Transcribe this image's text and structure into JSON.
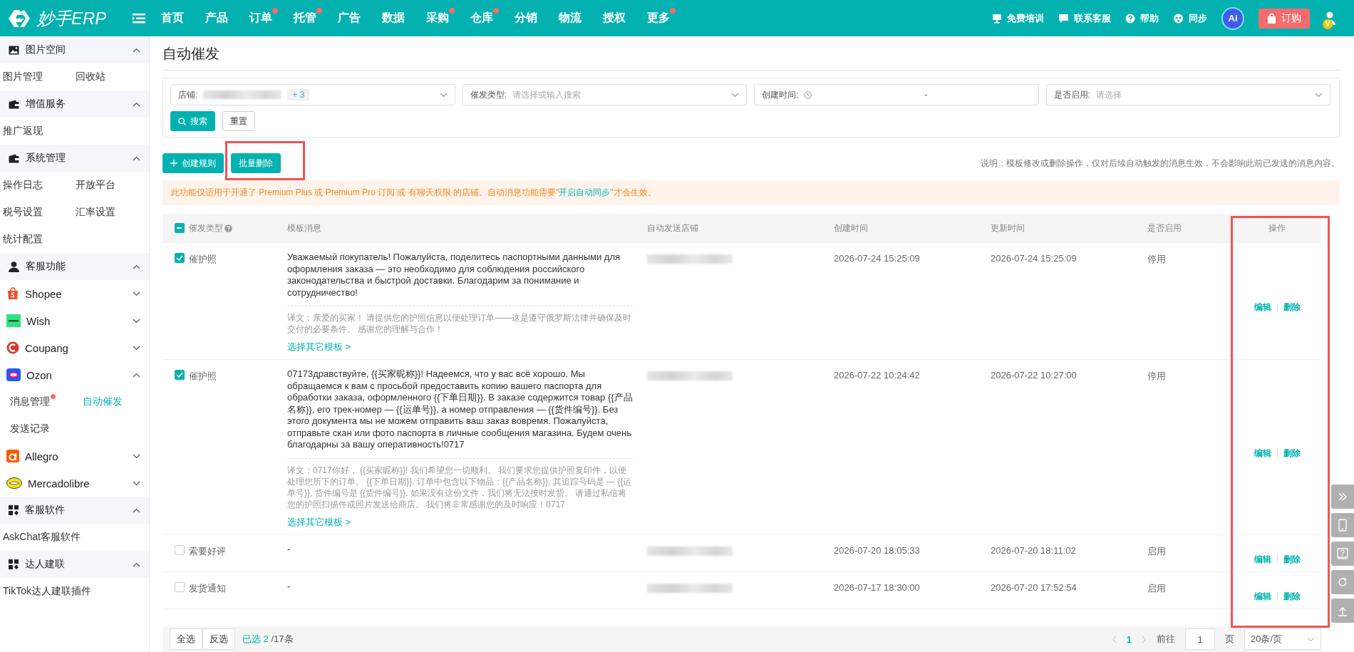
{
  "brand": {
    "name": "妙手ERP"
  },
  "nav": [
    {
      "label": "首页",
      "badge": false
    },
    {
      "label": "产品",
      "badge": false
    },
    {
      "label": "订单",
      "badge": true
    },
    {
      "label": "托管",
      "badge": true
    },
    {
      "label": "广告",
      "badge": false
    },
    {
      "label": "数据",
      "badge": false
    },
    {
      "label": "采购",
      "badge": true
    },
    {
      "label": "仓库",
      "badge": true
    },
    {
      "label": "分销",
      "badge": false
    },
    {
      "label": "物流",
      "badge": false
    },
    {
      "label": "授权",
      "badge": false
    },
    {
      "label": "更多",
      "badge": true
    }
  ],
  "top_actions": [
    {
      "label": "免费培训"
    },
    {
      "label": "联系客服"
    },
    {
      "label": "帮助"
    },
    {
      "label": "同步"
    }
  ],
  "ai_badge": "Ai",
  "order_button": "订购",
  "user_badge": "V",
  "sidebar": [
    {
      "title": "图片空间",
      "expanded": true,
      "items": [
        {
          "label": "图片管理",
          "selected": false
        },
        {
          "label": "回收站",
          "selected": false
        }
      ]
    },
    {
      "title": "增值服务",
      "expanded": true,
      "items": [
        {
          "label": "推广返现",
          "selected": false
        }
      ]
    },
    {
      "title": "系统管理",
      "expanded": true,
      "items": [
        {
          "label": "操作日志",
          "selected": false
        },
        {
          "label": "开放平台",
          "selected": false
        },
        {
          "label": "税号设置",
          "selected": false
        },
        {
          "label": "汇率设置",
          "selected": false
        },
        {
          "label": "统计配置",
          "selected": false
        }
      ]
    },
    {
      "title": "客服功能",
      "expanded": true,
      "platforms": [
        {
          "name": "Shopee",
          "expanded": false
        },
        {
          "name": "Wish",
          "expanded": false
        },
        {
          "name": "Coupang",
          "expanded": false
        },
        {
          "name": "Ozon",
          "expanded": true,
          "children": [
            {
              "label": "消息管理",
              "badge": true,
              "selected": false
            },
            {
              "label": "自动催发",
              "badge": false,
              "selected": true
            },
            {
              "label": "发送记录",
              "badge": false,
              "selected": false
            }
          ]
        },
        {
          "name": "Allegro",
          "expanded": false
        },
        {
          "name": "Mercadolibre",
          "expanded": false
        }
      ]
    },
    {
      "title": "客服软件",
      "expanded": true,
      "items": [
        {
          "label": "AskChat客服软件",
          "selected": false
        }
      ]
    },
    {
      "title": "达人建联",
      "expanded": true,
      "items": [
        {
          "label": "TikTok达人建联插件",
          "selected": false
        }
      ]
    }
  ],
  "page_title": "自动催发",
  "filters": [
    {
      "kind": "select",
      "label": "店铺:",
      "redacted": true,
      "tag": "+ 3"
    },
    {
      "kind": "select",
      "label": "催发类型:",
      "placeholder": "请选择或输入搜索"
    },
    {
      "kind": "daterange",
      "label": "创建时间:",
      "separator": "-"
    },
    {
      "kind": "select",
      "label": "是否启用:",
      "placeholder": "请选择"
    }
  ],
  "search_button": "搜索",
  "reset_button": "重置",
  "create_button": "创建规则",
  "batch_delete_button": {
    "label": "批量删除",
    "highlighted": true
  },
  "hint": "说明：模板修改或删除操作，仅对后续自动触发的消息生效，不会影响此前已发送的消息内容。",
  "notice": {
    "before": "此功能仅适用于开通了 Premium Plus 或 Premium Pro 订阅 或 有聊天权限 的店铺。自动消息功能需要\"",
    "link": "开启自动同步",
    "after": "\"才会生效。"
  },
  "table": {
    "select_all_indeterminate": true,
    "actions_highlighted": true,
    "columns": [
      "催发类型",
      "模板消息",
      "自动发送店铺",
      "创建时间",
      "更新时间",
      "是否启用",
      "操作"
    ],
    "rows": [
      {
        "checked": true,
        "type": "催护照",
        "message": "Уважаемый покупатель! Пожалуйста, поделитесь паспортными данными для оформления заказа — это необходимо для соблюдения российского законодательства и быстрой доставки. Благодарим за понимание и сотрудничество!",
        "translation": "译文：亲爱的买家！ 请提供您的护照信息以便处理订单——这是遵守俄罗斯法律并确保及时交付的必要条件。 感谢您的理解与合作！",
        "more": "选择其它模板 >",
        "store_redacted": true,
        "created": "2026-07-24 15:25:09",
        "updated": "2026-07-24 15:25:09",
        "enabled": "停用",
        "actions": [
          "编辑",
          "删除"
        ]
      },
      {
        "checked": true,
        "type": "催护照",
        "message": "07173дравствуйте, {{买家昵称}}! Надеемся, что у вас всё хорошо. Мы обращаемся к вам с просьбой предоставить копию вашего паспорта для обработки заказа, оформленного {{下单日期}}. В заказе содержится товар {{产品名称}}, его трек-номер — {{运单号}}, а номер отправления — {{货件编号}}. Без этого документа мы не можем отправить ваш заказ вовремя. Пожалуйста, отправьте скан или фото паспорта в личные сообщения магазина. Будем очень благодарны за вашу оперативность!0717",
        "translation": "译文：0717你好， {{买家昵称}}! 我们希望您一切顺利。 我们要求您提供护照复印件，以便处理您所下的订单。 {{下单日期}}. 订单中包含以下物品：{{产品名称}}, 其追踪号码是 — {{运单号}}, 货件编号是 {{货件编号}}. 如果没有这份文件，我们将无法按时发货。 请通过私信将您的护照扫描件或照片发送给商店。 我们将非常感谢您的及时响应！0717",
        "more": "选择其它模板 >",
        "store_redacted": true,
        "created": "2026-07-22 10:24:42",
        "updated": "2026-07-22 10:27:00",
        "enabled": "停用",
        "actions": [
          "编辑",
          "删除"
        ]
      },
      {
        "checked": false,
        "type": "索要好评",
        "message": "-",
        "store_redacted": true,
        "created": "2026-07-20 18:05:33",
        "updated": "2026-07-20 18:11:02",
        "enabled": "启用",
        "actions": [
          "编辑",
          "删除"
        ]
      },
      {
        "checked": false,
        "type": "发货通知",
        "message": "-",
        "store_redacted": true,
        "created": "2026-07-17 18:30:00",
        "updated": "2026-07-20 17:52:54",
        "enabled": "启用",
        "actions": [
          "编辑",
          "删除"
        ]
      }
    ]
  },
  "footer": {
    "select_all": "全选",
    "invert": "反选",
    "selected": "已选 2",
    "total": "/17条"
  },
  "pagination": {
    "current": "1",
    "goto_label": "前往",
    "page_input": "1",
    "page_unit": "页",
    "page_size": "20条/页"
  }
}
